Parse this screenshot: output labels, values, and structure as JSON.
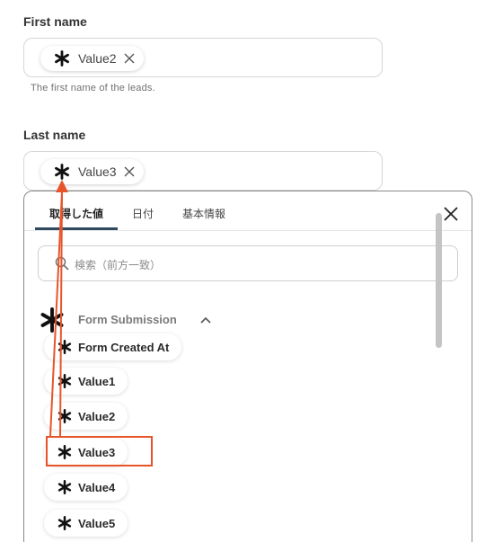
{
  "first_name": {
    "label": "First name",
    "chip": "Value2",
    "hint": "The first name of the leads."
  },
  "last_name": {
    "label": "Last name",
    "chip": "Value3"
  },
  "panel": {
    "tabs": [
      "取得した値",
      "日付",
      "基本情報"
    ],
    "active_tab": "取得した値",
    "search_placeholder": "検索（前方一致）",
    "group": {
      "title": "Form Submission",
      "expanded": true,
      "items": [
        "Form Created At",
        "Value1",
        "Value2",
        "Value3",
        "Value4",
        "Value5"
      ]
    },
    "highlighted_item": "Value3"
  },
  "colors": {
    "annotation": "#e8542a",
    "tab_underline": "#2f4a5e"
  }
}
